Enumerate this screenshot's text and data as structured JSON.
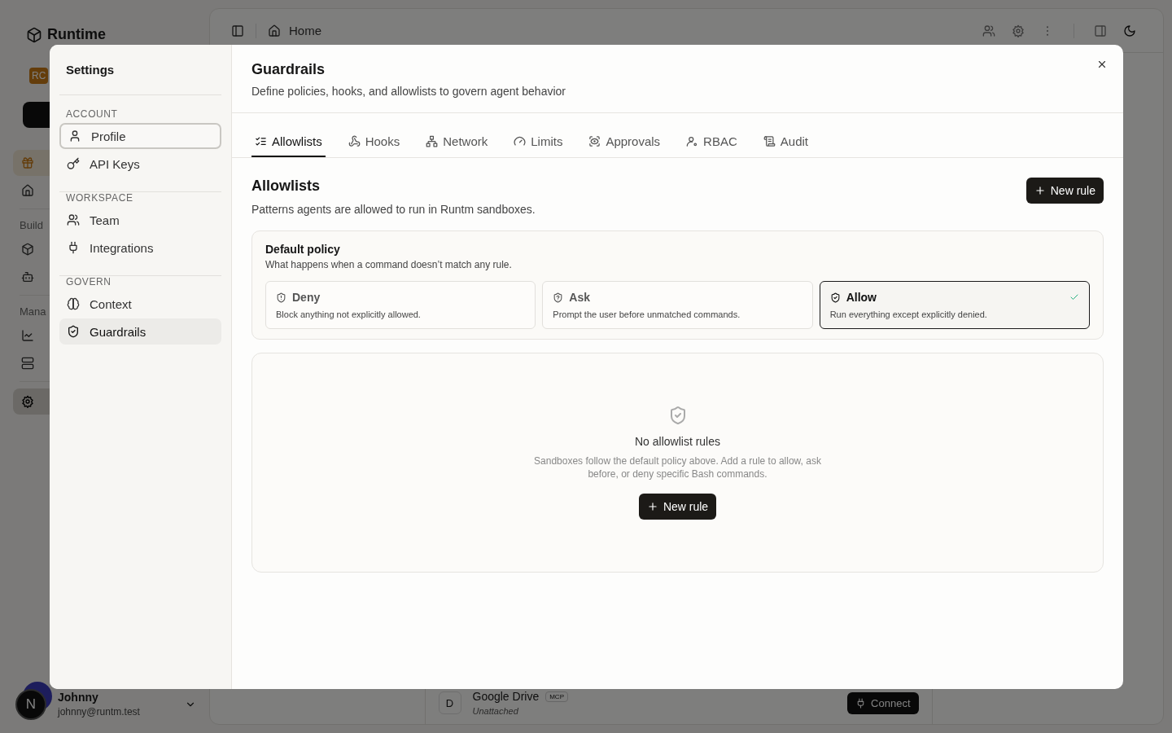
{
  "app": {
    "logo": "Runtime",
    "org_badge": "RC",
    "nav_groups": [
      {
        "items": [
          {
            "selected": false,
            "promo": true
          },
          {
            "selected": false,
            "promo": false
          }
        ]
      },
      {
        "section": "Build",
        "items": [
          {
            "selected": false,
            "promo": false
          },
          {
            "selected": false,
            "promo": false
          }
        ]
      },
      {
        "section": "Mana",
        "items": [
          {
            "selected": false,
            "promo": false
          },
          {
            "selected": false,
            "promo": false
          }
        ]
      },
      {
        "items": [
          {
            "selected": true,
            "promo": false
          }
        ]
      }
    ],
    "user": {
      "name": "Johnny",
      "email": "johnny@runtm.test",
      "avatar": "N"
    },
    "breadcrumb": "Home",
    "integration": {
      "initial": "D",
      "name": "Google Drive",
      "badge": "MCP",
      "status": "Unattached",
      "button": "Connect"
    }
  },
  "settings": {
    "title": "Settings",
    "groups": [
      {
        "heading": "ACCOUNT",
        "items": [
          {
            "label": "Profile",
            "selected": false,
            "focused": true
          },
          {
            "label": "API Keys",
            "selected": false,
            "focused": false
          }
        ]
      },
      {
        "heading": "WORKSPACE",
        "items": [
          {
            "label": "Team",
            "selected": false,
            "focused": false
          },
          {
            "label": "Integrations",
            "selected": false,
            "focused": false
          }
        ]
      },
      {
        "heading": "GOVERN",
        "items": [
          {
            "label": "Context",
            "selected": false,
            "focused": false
          },
          {
            "label": "Guardrails",
            "selected": true,
            "focused": false
          }
        ]
      }
    ],
    "panel": {
      "title": "Guardrails",
      "subtitle": "Define policies, hooks, and allowlists to govern agent behavior",
      "tabs": [
        {
          "label": "Allowlists",
          "selected": true
        },
        {
          "label": "Hooks",
          "selected": false
        },
        {
          "label": "Network",
          "selected": false
        },
        {
          "label": "Limits",
          "selected": false
        },
        {
          "label": "Approvals",
          "selected": false
        },
        {
          "label": "RBAC",
          "selected": false
        },
        {
          "label": "Audit",
          "selected": false
        }
      ],
      "section_title": "Allowlists",
      "section_description": "Patterns agents are allowed to run in Runtm sandboxes.",
      "new_rule_button": "New rule",
      "default_policy": {
        "title": "Default policy",
        "description": "What happens when a command doesn’t match any rule.",
        "options": [
          {
            "kind": "deny",
            "label": "Deny",
            "description": "Block anything not explicitly allowed.",
            "selected": false
          },
          {
            "kind": "ask",
            "label": "Ask",
            "description": "Prompt the user before unmatched commands.",
            "selected": false
          },
          {
            "kind": "allow",
            "label": "Allow",
            "description": "Run everything except explicitly denied.",
            "selected": true
          }
        ]
      },
      "empty_state": {
        "title": "No allowlist rules",
        "description": "Sandboxes follow the default policy above. Add a rule to allow, ask before, or deny specific Bash commands.",
        "button": "New rule"
      }
    }
  }
}
